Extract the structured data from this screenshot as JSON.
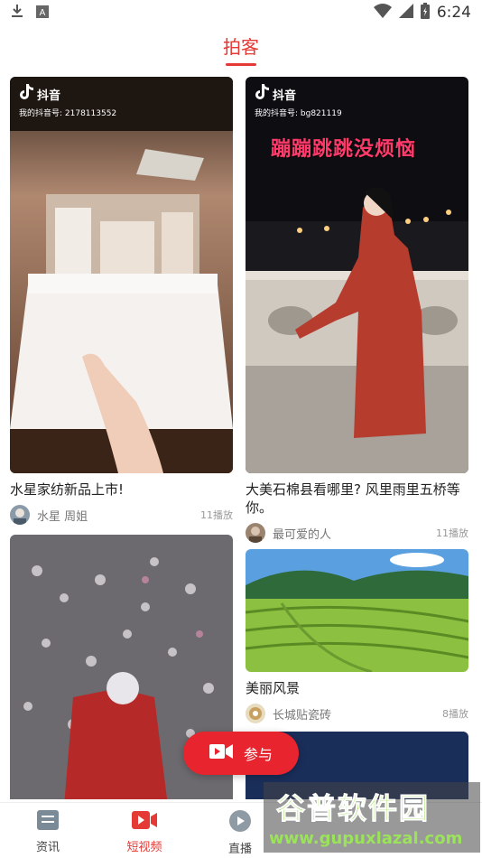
{
  "status_bar": {
    "time": "6:24",
    "left_icons": [
      "download-icon",
      "a-icon"
    ],
    "right_icons": [
      "wifi-icon",
      "signal-icon",
      "battery-icon"
    ]
  },
  "header": {
    "title": "拍客",
    "accent_color": "#e53935"
  },
  "feed": [
    {
      "title": "水星家纺新品上市!",
      "author": "水星 周姐",
      "plays": "11播放",
      "watermark": {
        "brand": "抖音",
        "id": "我的抖音号: 2178113552"
      }
    },
    {
      "title": "大美石棉县看哪里? 风里雨里五桥等你。",
      "author": "最可爱的人",
      "plays": "11播放",
      "watermark": {
        "brand": "抖音",
        "id": "我的抖音号: bg821119"
      },
      "overlay_caption": "蹦蹦跳跳没烦恼"
    },
    {
      "title": "美丽风景",
      "author": "长城贴瓷砖",
      "plays": "8播放"
    }
  ],
  "join_button": {
    "label": "参与"
  },
  "bottom_nav": [
    {
      "label": "资讯",
      "icon": "news-icon",
      "active": false
    },
    {
      "label": "短视频",
      "icon": "video-camera-icon",
      "active": true
    },
    {
      "label": "直播",
      "icon": "play-circle-icon",
      "active": false
    }
  ],
  "watermark_site": {
    "title": "谷普软件园",
    "url": "www.gupuxlazal.com"
  }
}
